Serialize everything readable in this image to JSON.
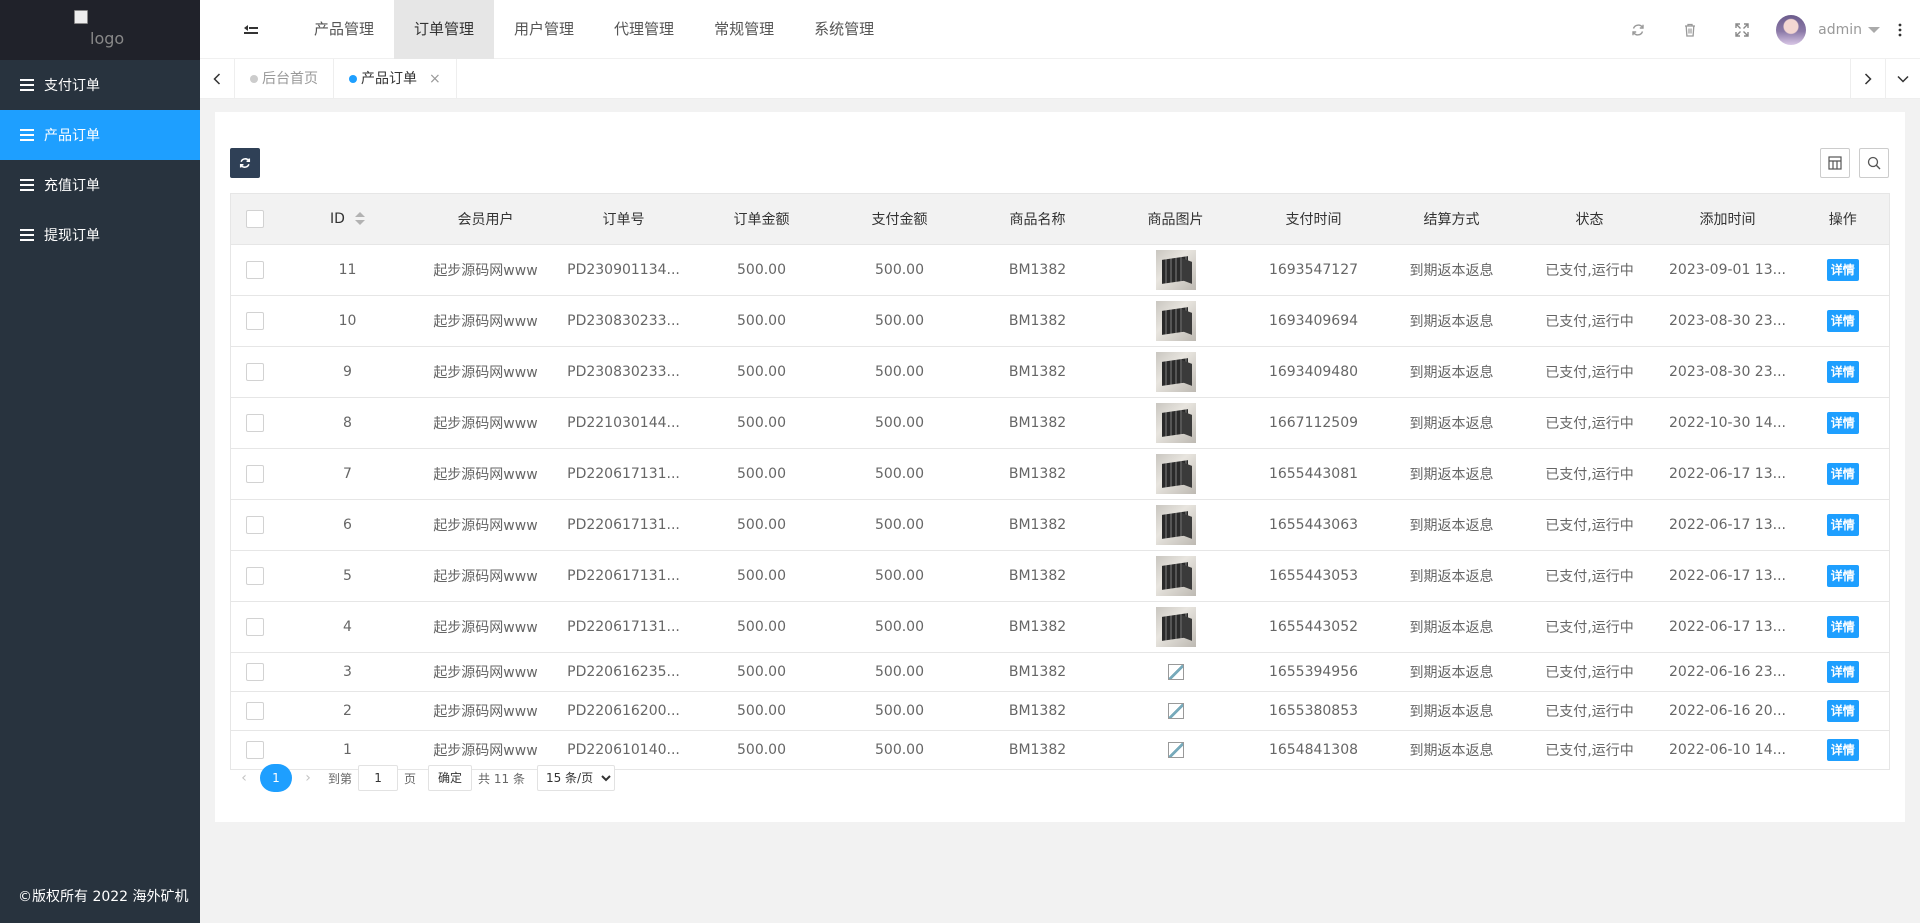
{
  "sidebar": {
    "logo_alt": "logo",
    "items": [
      {
        "label": "支付订单",
        "active": false
      },
      {
        "label": "产品订单",
        "active": true
      },
      {
        "label": "充值订单",
        "active": false
      },
      {
        "label": "提现订单",
        "active": false
      }
    ],
    "copyright": "©版权所有 2022 海外矿机"
  },
  "header": {
    "nav": [
      "产品管理",
      "订单管理",
      "用户管理",
      "代理管理",
      "常规管理",
      "系统管理"
    ],
    "active_nav": "订单管理",
    "username": "admin",
    "tool_icons": [
      "refresh-icon",
      "trash-icon",
      "fullscreen-icon",
      "more-vertical-icon"
    ]
  },
  "tabs": {
    "items": [
      {
        "label": "后台首页",
        "active": false
      },
      {
        "label": "产品订单",
        "active": true
      }
    ],
    "close_glyph": "×"
  },
  "table": {
    "columns": [
      "ID",
      "会员用户",
      "订单号",
      "订单金额",
      "支付金额",
      "商品名称",
      "商品图片",
      "支付时间",
      "结算方式",
      "状态",
      "添加时间",
      "操作"
    ],
    "detail_label": "详情",
    "rows": [
      {
        "id": "11",
        "user": "起步源码网www",
        "order_no": "PD230901134...",
        "order_amount": "500.00",
        "pay_amount": "500.00",
        "product": "BM1382",
        "image": "thumb",
        "pay_time": "1693547127",
        "settlement": "到期返本返息",
        "status": "已支付,运行中",
        "add_time": "2023-09-01 13..."
      },
      {
        "id": "10",
        "user": "起步源码网www",
        "order_no": "PD230830233...",
        "order_amount": "500.00",
        "pay_amount": "500.00",
        "product": "BM1382",
        "image": "thumb",
        "pay_time": "1693409694",
        "settlement": "到期返本返息",
        "status": "已支付,运行中",
        "add_time": "2023-08-30 23..."
      },
      {
        "id": "9",
        "user": "起步源码网www",
        "order_no": "PD230830233...",
        "order_amount": "500.00",
        "pay_amount": "500.00",
        "product": "BM1382",
        "image": "thumb",
        "pay_time": "1693409480",
        "settlement": "到期返本返息",
        "status": "已支付,运行中",
        "add_time": "2023-08-30 23..."
      },
      {
        "id": "8",
        "user": "起步源码网www",
        "order_no": "PD221030144...",
        "order_amount": "500.00",
        "pay_amount": "500.00",
        "product": "BM1382",
        "image": "thumb",
        "pay_time": "1667112509",
        "settlement": "到期返本返息",
        "status": "已支付,运行中",
        "add_time": "2022-10-30 14..."
      },
      {
        "id": "7",
        "user": "起步源码网www",
        "order_no": "PD220617131...",
        "order_amount": "500.00",
        "pay_amount": "500.00",
        "product": "BM1382",
        "image": "thumb",
        "pay_time": "1655443081",
        "settlement": "到期返本返息",
        "status": "已支付,运行中",
        "add_time": "2022-06-17 13..."
      },
      {
        "id": "6",
        "user": "起步源码网www",
        "order_no": "PD220617131...",
        "order_amount": "500.00",
        "pay_amount": "500.00",
        "product": "BM1382",
        "image": "thumb",
        "pay_time": "1655443063",
        "settlement": "到期返本返息",
        "status": "已支付,运行中",
        "add_time": "2022-06-17 13..."
      },
      {
        "id": "5",
        "user": "起步源码网www",
        "order_no": "PD220617131...",
        "order_amount": "500.00",
        "pay_amount": "500.00",
        "product": "BM1382",
        "image": "thumb",
        "pay_time": "1655443053",
        "settlement": "到期返本返息",
        "status": "已支付,运行中",
        "add_time": "2022-06-17 13..."
      },
      {
        "id": "4",
        "user": "起步源码网www",
        "order_no": "PD220617131...",
        "order_amount": "500.00",
        "pay_amount": "500.00",
        "product": "BM1382",
        "image": "thumb",
        "pay_time": "1655443052",
        "settlement": "到期返本返息",
        "status": "已支付,运行中",
        "add_time": "2022-06-17 13..."
      },
      {
        "id": "3",
        "user": "起步源码网www",
        "order_no": "PD220616235...",
        "order_amount": "500.00",
        "pay_amount": "500.00",
        "product": "BM1382",
        "image": "broken",
        "pay_time": "1655394956",
        "settlement": "到期返本返息",
        "status": "已支付,运行中",
        "add_time": "2022-06-16 23..."
      },
      {
        "id": "2",
        "user": "起步源码网www",
        "order_no": "PD220616200...",
        "order_amount": "500.00",
        "pay_amount": "500.00",
        "product": "BM1382",
        "image": "broken",
        "pay_time": "1655380853",
        "settlement": "到期返本返息",
        "status": "已支付,运行中",
        "add_time": "2022-06-16 20..."
      },
      {
        "id": "1",
        "user": "起步源码网www",
        "order_no": "PD220610140...",
        "order_amount": "500.00",
        "pay_amount": "500.00",
        "product": "BM1382",
        "image": "broken",
        "pay_time": "1654841308",
        "settlement": "到期返本返息",
        "status": "已支付,运行中",
        "add_time": "2022-06-10 14..."
      }
    ]
  },
  "pagination": {
    "current": "1",
    "goto_label": "到第",
    "goto_value": "1",
    "page_unit": "页",
    "confirm_label": "确定",
    "total_label": "共 11 条",
    "page_size_options": [
      "15 条/页"
    ],
    "page_size": "15 条/页"
  },
  "colors": {
    "sidebar_bg": "#28333e",
    "accent": "#1e9fff",
    "refresh_btn": "#2f4056"
  }
}
